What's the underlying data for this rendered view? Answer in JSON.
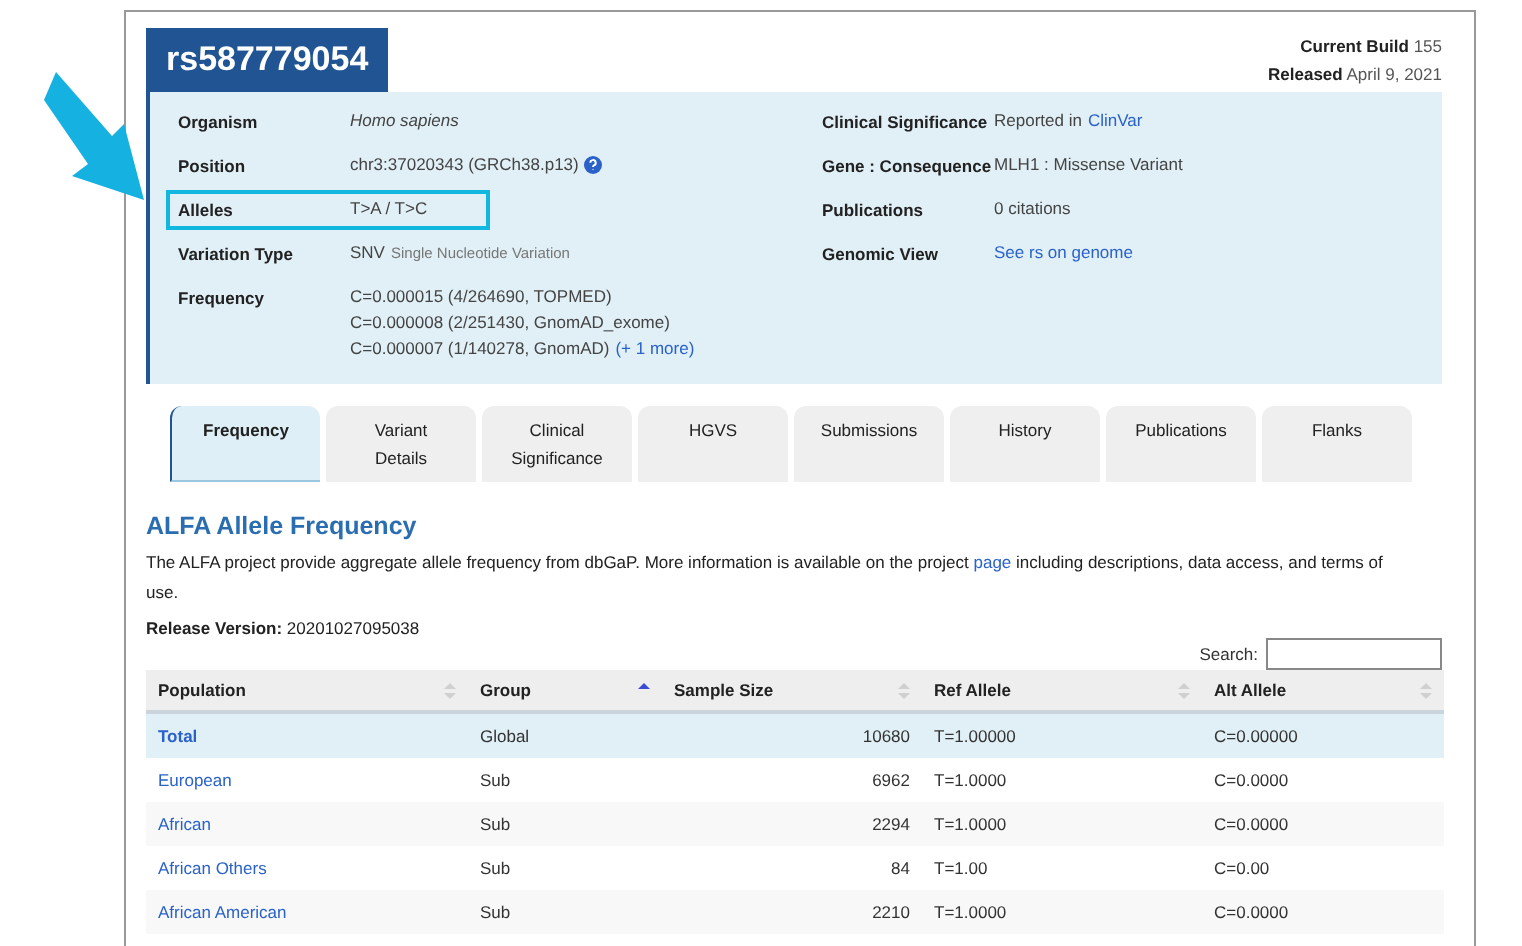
{
  "variant_id": "rs587779054",
  "build": {
    "current_label": "Current Build",
    "current_value": "155",
    "released_label": "Released",
    "released_value": "April 9, 2021"
  },
  "summary_left": [
    {
      "label": "Organism",
      "highlighted": false,
      "help": false,
      "lines": [
        [
          {
            "kind": "italic",
            "text": "Homo sapiens"
          }
        ]
      ]
    },
    {
      "label": "Position",
      "highlighted": false,
      "help": true,
      "lines": [
        [
          {
            "kind": "plain",
            "text": "chr3:37020343 (GRCh38.p13)"
          }
        ]
      ]
    },
    {
      "label": "Alleles",
      "highlighted": true,
      "help": false,
      "lines": [
        [
          {
            "kind": "plain",
            "text": "T>A / T>C"
          }
        ]
      ]
    },
    {
      "label": "Variation Type",
      "highlighted": false,
      "help": false,
      "lines": [
        [
          {
            "kind": "plain",
            "text": "SNV"
          },
          {
            "kind": "note",
            "text": "Single Nucleotide Variation"
          }
        ]
      ]
    },
    {
      "label": "Frequency",
      "highlighted": false,
      "help": false,
      "lines": [
        [
          {
            "kind": "plain",
            "text": "C=0.000015 (4/264690, TOPMED)"
          }
        ],
        [
          {
            "kind": "plain",
            "text": "C=0.000008 (2/251430, GnomAD_exome)"
          }
        ],
        [
          {
            "kind": "plain",
            "text": "C=0.000007 (1/140278, GnomAD)"
          },
          {
            "kind": "link",
            "text": "(+ 1 more)"
          }
        ]
      ]
    }
  ],
  "summary_right": [
    {
      "label": "Clinical Significance",
      "highlighted": false,
      "help": false,
      "lines": [
        [
          {
            "kind": "plain",
            "text": "Reported in"
          },
          {
            "kind": "link",
            "text": "ClinVar"
          }
        ]
      ]
    },
    {
      "label": "Gene : Consequence",
      "highlighted": false,
      "help": false,
      "lines": [
        [
          {
            "kind": "plain",
            "text": "MLH1 : Missense Variant"
          }
        ]
      ]
    },
    {
      "label": "Publications",
      "highlighted": false,
      "help": false,
      "lines": [
        [
          {
            "kind": "plain",
            "text": "0 citations"
          }
        ]
      ]
    },
    {
      "label": "Genomic View",
      "highlighted": false,
      "help": false,
      "lines": [
        [
          {
            "kind": "link",
            "text": "See rs on genome"
          }
        ]
      ]
    }
  ],
  "tabs": [
    {
      "label": "Frequency",
      "selected": true
    },
    {
      "label": "Variant Details",
      "selected": false
    },
    {
      "label": "Clinical Significance",
      "selected": false
    },
    {
      "label": "HGVS",
      "selected": false
    },
    {
      "label": "Submissions",
      "selected": false
    },
    {
      "label": "History",
      "selected": false
    },
    {
      "label": "Publications",
      "selected": false
    },
    {
      "label": "Flanks",
      "selected": false
    }
  ],
  "section": {
    "title": "ALFA Allele Frequency",
    "description": [
      {
        "kind": "plain",
        "text": "The ALFA project provide aggregate allele frequency from dbGaP. More information is available on the project "
      },
      {
        "kind": "link",
        "text": "page"
      },
      {
        "kind": "plain",
        "text": " including descriptions, data access, and terms of use."
      }
    ],
    "release_label": "Release Version:",
    "release_value": "20201027095038",
    "search_label": "Search:"
  },
  "table": {
    "columns": [
      {
        "label": "Population",
        "sorted": false,
        "numeric": false
      },
      {
        "label": "Group",
        "sorted": true,
        "numeric": false
      },
      {
        "label": "Sample Size",
        "sorted": false,
        "numeric": true
      },
      {
        "label": "Ref Allele",
        "sorted": false,
        "numeric": false
      },
      {
        "label": "Alt Allele",
        "sorted": false,
        "numeric": false
      }
    ],
    "rows": [
      {
        "selected": true,
        "cells": [
          "Total",
          "Global",
          "10680",
          "T=1.00000",
          "C=0.00000"
        ]
      },
      {
        "selected": false,
        "cells": [
          "European",
          "Sub",
          "6962",
          "T=1.0000",
          "C=0.0000"
        ]
      },
      {
        "selected": false,
        "cells": [
          "African",
          "Sub",
          "2294",
          "T=1.0000",
          "C=0.0000"
        ]
      },
      {
        "selected": false,
        "cells": [
          "African Others",
          "Sub",
          "84",
          "T=1.00",
          "C=0.00"
        ]
      },
      {
        "selected": false,
        "cells": [
          "African American",
          "Sub",
          "2210",
          "T=1.0000",
          "C=0.0000"
        ]
      }
    ]
  }
}
